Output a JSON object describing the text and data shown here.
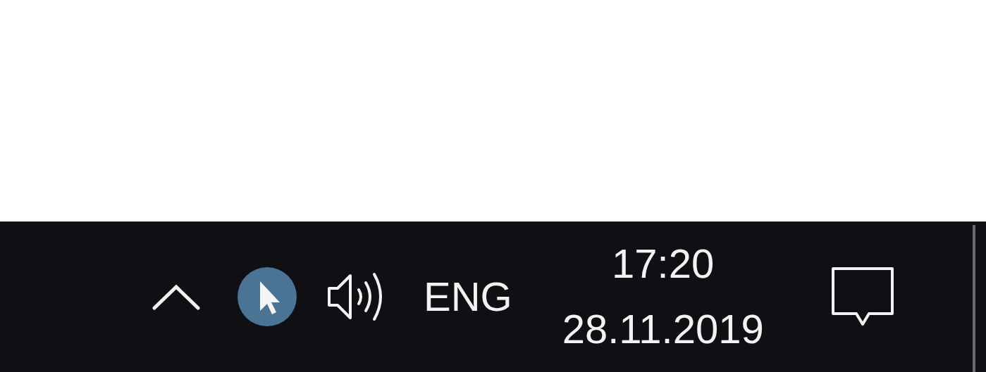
{
  "taskbar": {
    "language": "ENG",
    "clock": {
      "time": "17:20",
      "date": "28.11.2019"
    }
  }
}
